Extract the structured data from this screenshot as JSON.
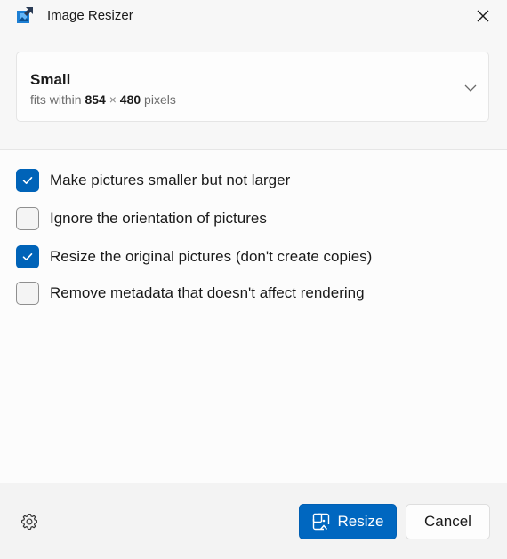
{
  "window": {
    "title": "Image Resizer",
    "app_icon": "image-resizer-app-icon",
    "close_icon": "close-icon"
  },
  "size_preset": {
    "name": "Small",
    "desc_prefix": "fits within",
    "width": "854",
    "times": "×",
    "height": "480",
    "unit": "pixels",
    "dropdown_icon": "chevron-down-icon"
  },
  "options": [
    {
      "label": "Make pictures smaller but not larger",
      "checked": true
    },
    {
      "label": "Ignore the orientation of pictures",
      "checked": false
    },
    {
      "label": "Resize the original pictures (don't create copies)",
      "checked": true
    },
    {
      "label": "Remove metadata that doesn't affect rendering",
      "checked": false
    }
  ],
  "footer": {
    "settings_icon": "gear-icon",
    "resize_label": "Resize",
    "resize_icon": "resize-icon",
    "cancel_label": "Cancel"
  },
  "colors": {
    "accent": "#0067c0",
    "background": "#f7f7f7",
    "checkbox_checked": "#0063b8"
  }
}
